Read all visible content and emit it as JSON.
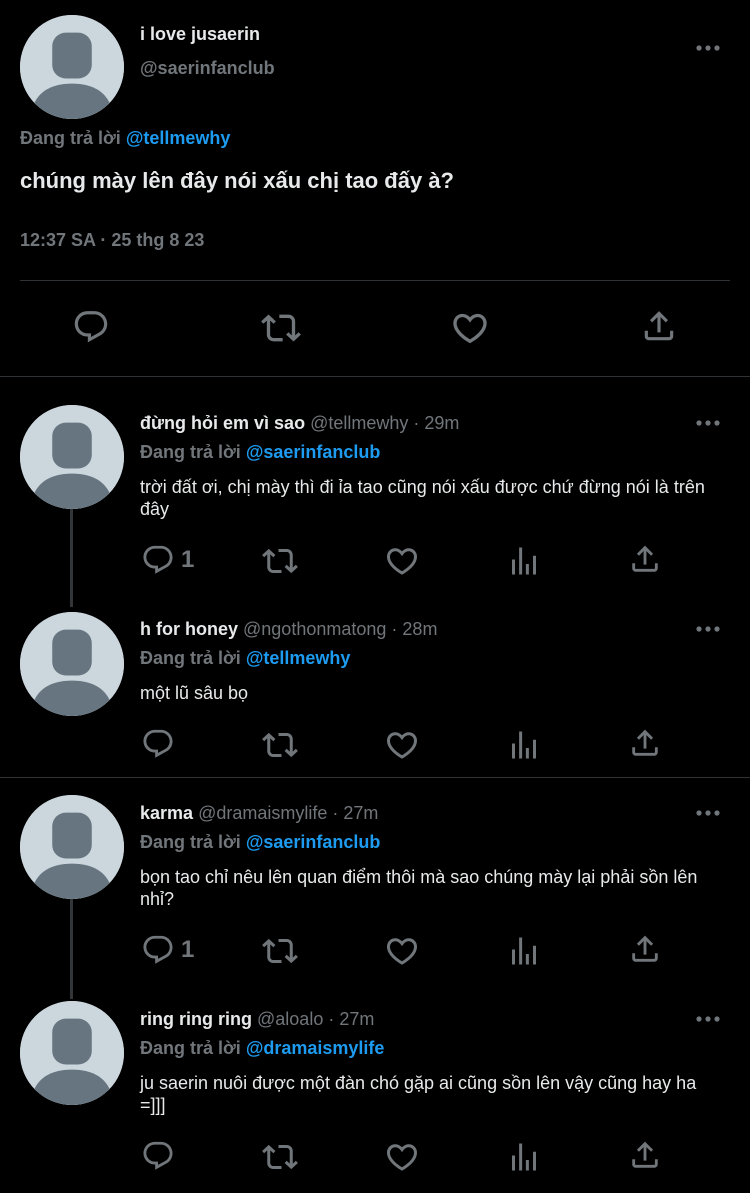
{
  "main_tweet": {
    "display_name": "i love jusaerin",
    "handle": "@saerinfanclub",
    "replying_prefix": "Đang trả lời",
    "replying_to": "@tellmewhy",
    "text": "chúng mày lên đây nói xấu chị tao đấy à?",
    "timestamp": "12:37 SA · 25 thg 8 23"
  },
  "replies": [
    {
      "display_name": "đừng hỏi em vì sao",
      "handle": "@tellmewhy",
      "time": "· 29m",
      "replying_prefix": "Đang trả lời",
      "replying_to": "@saerinfanclub",
      "text": "trời đất ơi, chị mày thì đi ỉa tao cũng nói xấu được chứ đừng nói là trên đây",
      "reply_count": "1"
    },
    {
      "display_name": "h for honey",
      "handle": "@ngothonmatong",
      "time": "· 28m",
      "replying_prefix": "Đang trả lời",
      "replying_to": "@tellmewhy",
      "text": "một lũ sâu bọ",
      "reply_count": ""
    },
    {
      "display_name": "karma",
      "handle": "@dramaismylife",
      "time": "· 27m",
      "replying_prefix": "Đang trả lời",
      "replying_to": "@saerinfanclub",
      "text": "bọn tao chỉ nêu lên quan điểm thôi mà sao chúng mày lại phải sồn lên nhỉ?",
      "reply_count": "1"
    },
    {
      "display_name": "ring ring ring",
      "handle": "@aloalo",
      "time": "· 27m",
      "replying_prefix": "Đang trả lời",
      "replying_to": "@dramaismylife",
      "text": "ju saerin nuôi được một đàn chó gặp ai cũng sồn lên vậy cũng hay ha =]]]",
      "reply_count": ""
    }
  ],
  "icons": {
    "reply": "reply-icon",
    "retweet": "retweet-icon",
    "like": "like-icon",
    "views": "views-icon",
    "share": "share-icon",
    "more": "more-icon"
  },
  "colors": {
    "background": "#000000",
    "text": "#e7e9ea",
    "muted": "#71767b",
    "link": "#1d9bf0",
    "divider": "#2f3336"
  }
}
